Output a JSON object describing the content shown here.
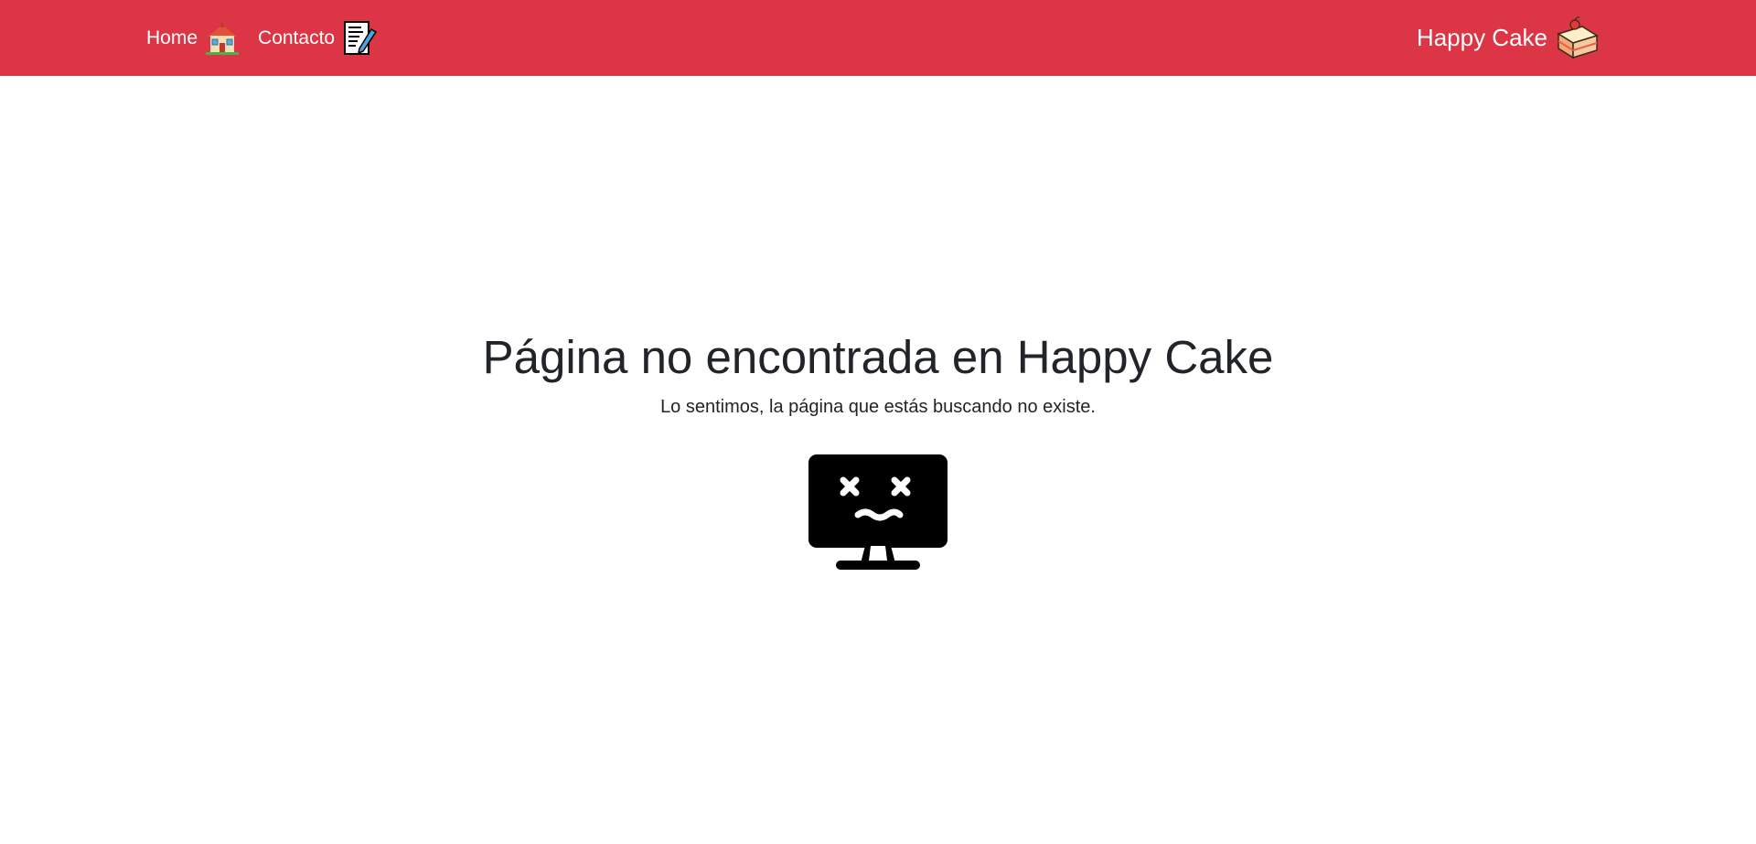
{
  "navbar": {
    "background": "#dc3545",
    "links": [
      {
        "label": "Home",
        "icon": "house-icon"
      },
      {
        "label": "Contacto",
        "icon": "memo-icon"
      }
    ],
    "brand": {
      "label": "Happy Cake",
      "icon": "cake-slice-icon"
    }
  },
  "main": {
    "title": "Página no encontrada en Happy Cake",
    "subtitle": "Lo sentimos, la página que estás buscando no existe.",
    "illustration": "broken-monitor-icon"
  }
}
